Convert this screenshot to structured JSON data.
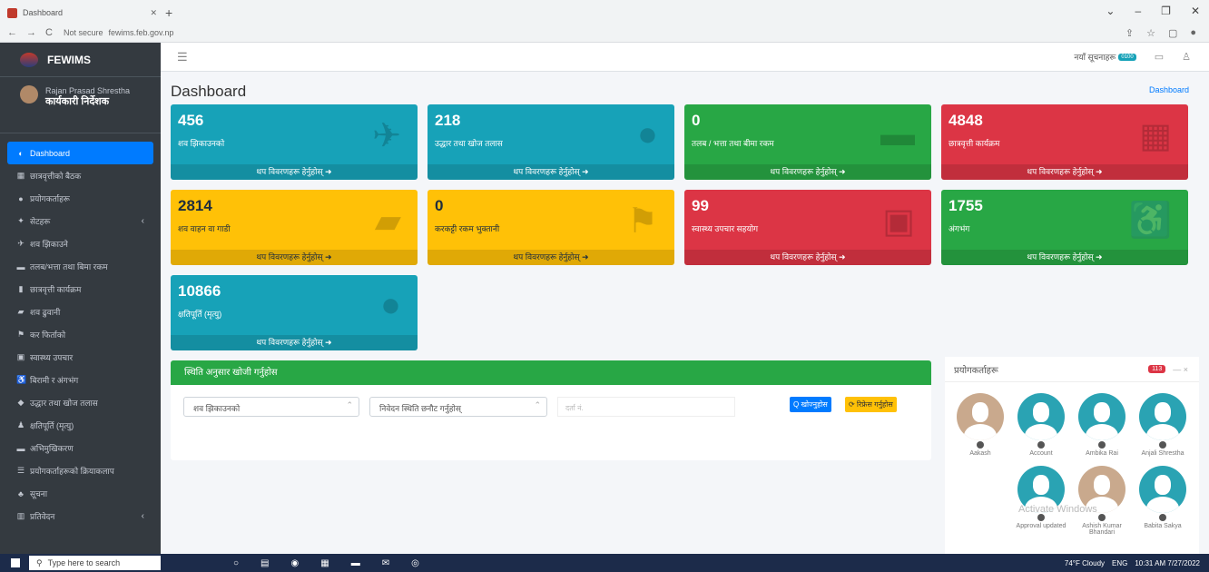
{
  "browser": {
    "tab_title": "Dashboard",
    "url_prefix": "Not secure",
    "url": "fewims.feb.gov.np"
  },
  "brand": {
    "name": "FEWIMS"
  },
  "user": {
    "name": "Rajan Prasad Shrestha",
    "role": "कार्यकारी निर्देशक"
  },
  "menu": [
    {
      "icon": "dashboard-icon",
      "glyph": "◐",
      "label": "Dashboard",
      "active": true
    },
    {
      "icon": "meeting-icon",
      "glyph": "▦",
      "label": "छात्रवृत्तीको बैठक"
    },
    {
      "icon": "users-icon",
      "glyph": "●",
      "label": "प्रयोगकर्ताहरू"
    },
    {
      "icon": "settings-icon",
      "glyph": "✦",
      "label": "सेटहरू",
      "caret": "‹"
    },
    {
      "icon": "plane-icon",
      "glyph": "✈",
      "label": "शव झिकाउने"
    },
    {
      "icon": "money-icon",
      "glyph": "▬",
      "label": "तलब/भत्ता तथा बिमा रकम"
    },
    {
      "icon": "scholarship-icon",
      "glyph": "▮",
      "label": "छात्रवृत्ती कार्यक्रम"
    },
    {
      "icon": "truck-icon",
      "glyph": "▰",
      "label": "शव ढुवानी"
    },
    {
      "icon": "flag-icon",
      "glyph": "⚑",
      "label": "कर फिर्ताको"
    },
    {
      "icon": "ambulance-icon",
      "glyph": "▣",
      "label": "स्वास्थ्य उपचार"
    },
    {
      "icon": "wheelchair-icon",
      "glyph": "♿",
      "label": "बिरामी र अंगभंग"
    },
    {
      "icon": "map-marker-icon",
      "glyph": "◆",
      "label": "उद्धार तथा खोज तलास"
    },
    {
      "icon": "user-icon",
      "glyph": "♟",
      "label": "क्षतिपूर्ति (मृत्यु)"
    },
    {
      "icon": "card-icon",
      "glyph": "▬",
      "label": "अभिमुखिकरण"
    },
    {
      "icon": "list-icon",
      "glyph": "☰",
      "label": "प्रयोगकर्ताहरूको क्रियाकलाप"
    },
    {
      "icon": "bell-icon",
      "glyph": "♣",
      "label": "सूचना"
    },
    {
      "icon": "chart-icon",
      "glyph": "▥",
      "label": "प्रतिवेदन",
      "caret": "‹"
    }
  ],
  "topbar": {
    "notice": "नयाँ सूचनाहरू",
    "notice_badge": "0100"
  },
  "page": {
    "title": "Dashboard",
    "breadcrumb": "Dashboard"
  },
  "more_link": "थप विवरणहरू हेर्नुहोस् ➜",
  "boxes": [
    {
      "value": "456",
      "label": "शव झिकाउनको",
      "color": "cyan",
      "icon": "plane-icon",
      "glyph": "✈"
    },
    {
      "value": "218",
      "label": "उद्धार तथा खोज तलास",
      "color": "cyan",
      "icon": "map-marker-icon",
      "glyph": "●"
    },
    {
      "value": "0",
      "label": "तलब / भत्ता तथा बीमा रकम",
      "color": "green",
      "icon": "money-icon",
      "glyph": "▬"
    },
    {
      "value": "4848",
      "label": "छात्रवृत्ती कार्यक्रम",
      "color": "red",
      "icon": "building-icon",
      "glyph": "▦"
    },
    {
      "value": "2814",
      "label": "शव वाहन वा गाडी",
      "color": "yellow",
      "icon": "truck-icon",
      "glyph": "▰"
    },
    {
      "value": "0",
      "label": "करकट्टी रकम भुक्तानी",
      "color": "yellow",
      "icon": "flag-icon",
      "glyph": "⚑"
    },
    {
      "value": "99",
      "label": "स्वास्थ्य उपचार सहयोग",
      "color": "red",
      "icon": "ambulance-icon",
      "glyph": "▣"
    },
    {
      "value": "1755",
      "label": "अंगभंग",
      "color": "green",
      "icon": "wheelchair-icon",
      "glyph": "♿"
    },
    {
      "value": "10866",
      "label": "क्षतिपूर्ति (मृत्यु)",
      "color": "cyan",
      "icon": "map-marker-icon",
      "glyph": "●"
    }
  ],
  "search": {
    "header": "स्थिति अनुसार खोजी गर्नुहोस",
    "select1": "शव झिकाउनको",
    "select2": "निवेदन स्थिति छनौट गर्नुहोस्",
    "input_placeholder": "दर्ता नं.",
    "search_btn": "Q खोज्नुहोस",
    "reset_btn": "⟳ रिफ्रेस गर्नुहोस"
  },
  "users_panel": {
    "title": "प्रयोगकर्ताहरू",
    "count": "113",
    "tools": "—  ×",
    "users": [
      {
        "name": "Aakash",
        "photo": true
      },
      {
        "name": "Account",
        "photo": false
      },
      {
        "name": "Ambika Rai",
        "photo": false
      },
      {
        "name": "Anjali Shrestha",
        "photo": false
      },
      {
        "name": "Approval updated",
        "photo": false
      },
      {
        "name": "Ashish Kumar Bhandari",
        "photo": true
      },
      {
        "name": "Babita Sakya",
        "photo": false
      }
    ]
  },
  "watermark": "Activate Windows",
  "taskbar": {
    "search": "Type here to search",
    "weather": "74°F Cloudy",
    "lang": "ENG",
    "time": "10:31 AM",
    "date": "7/27/2022"
  }
}
